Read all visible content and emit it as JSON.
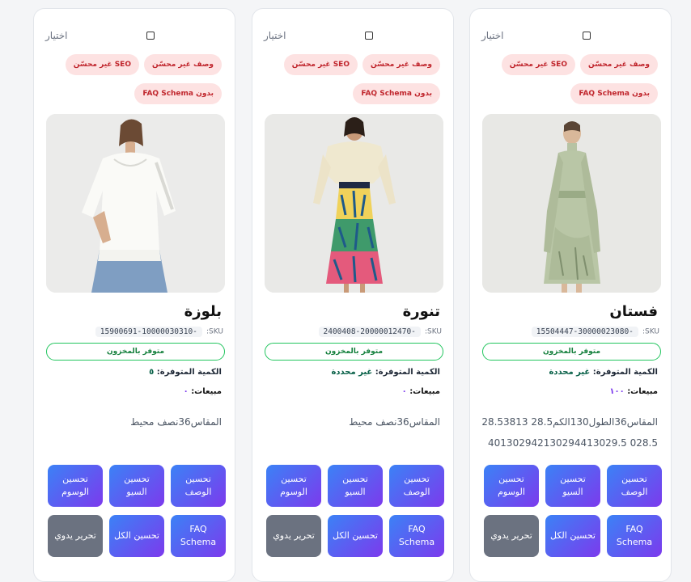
{
  "cards": [
    {
      "select_label": "اختيار",
      "tags": [
        "وصف غير محسّن",
        "SEO غير محسّن",
        "بدون FAQ Schema"
      ],
      "title": "فستان",
      "sku_label": "SKU:",
      "sku": "15504447-30000023080-",
      "stock": "متوفر بالمخزون",
      "qty_label": "الكمية المتوفرة:",
      "qty_value": "غير محددة",
      "sales_label": "مبيعات:",
      "sales_value": "١٠٠",
      "desc": "المقاس36الطول130الكم28.5 28.53813028.5 401302942130294413029.5",
      "buttons": [
        "تحسين الوصف",
        "تحسين السيو",
        "تحسين الوسوم",
        "FAQ Schema",
        "تحسين الكل",
        "تحرير يدوي"
      ]
    },
    {
      "select_label": "اختيار",
      "tags": [
        "وصف غير محسّن",
        "SEO غير محسّن",
        "بدون FAQ Schema"
      ],
      "title": "تنورة",
      "sku_label": "SKU:",
      "sku": "2400408-20000012470-",
      "stock": "متوفر بالمخزون",
      "qty_label": "الكمية المتوفرة:",
      "qty_value": "غير محددة",
      "sales_label": "مبيعات:",
      "sales_value": "٠",
      "desc": "المقاس36نصف محيط",
      "buttons": [
        "تحسين الوصف",
        "تحسين السيو",
        "تحسين الوسوم",
        "FAQ Schema",
        "تحسين الكل",
        "تحرير يدوي"
      ]
    },
    {
      "select_label": "اختيار",
      "tags": [
        "وصف غير محسّن",
        "SEO غير محسّن",
        "بدون FAQ Schema"
      ],
      "title": "بلوزة",
      "sku_label": "SKU:",
      "sku": "15900691-10000030310-",
      "stock": "متوفر بالمخزون",
      "qty_label": "الكمية المتوفرة:",
      "qty_value": "٥",
      "sales_label": "مبيعات:",
      "sales_value": "٠",
      "desc": "المقاس36نصف محيط",
      "buttons": [
        "تحسين الوصف",
        "تحسين السيو",
        "تحسين الوسوم",
        "FAQ Schema",
        "تحسين الكل",
        "تحرير يدوي"
      ]
    }
  ]
}
